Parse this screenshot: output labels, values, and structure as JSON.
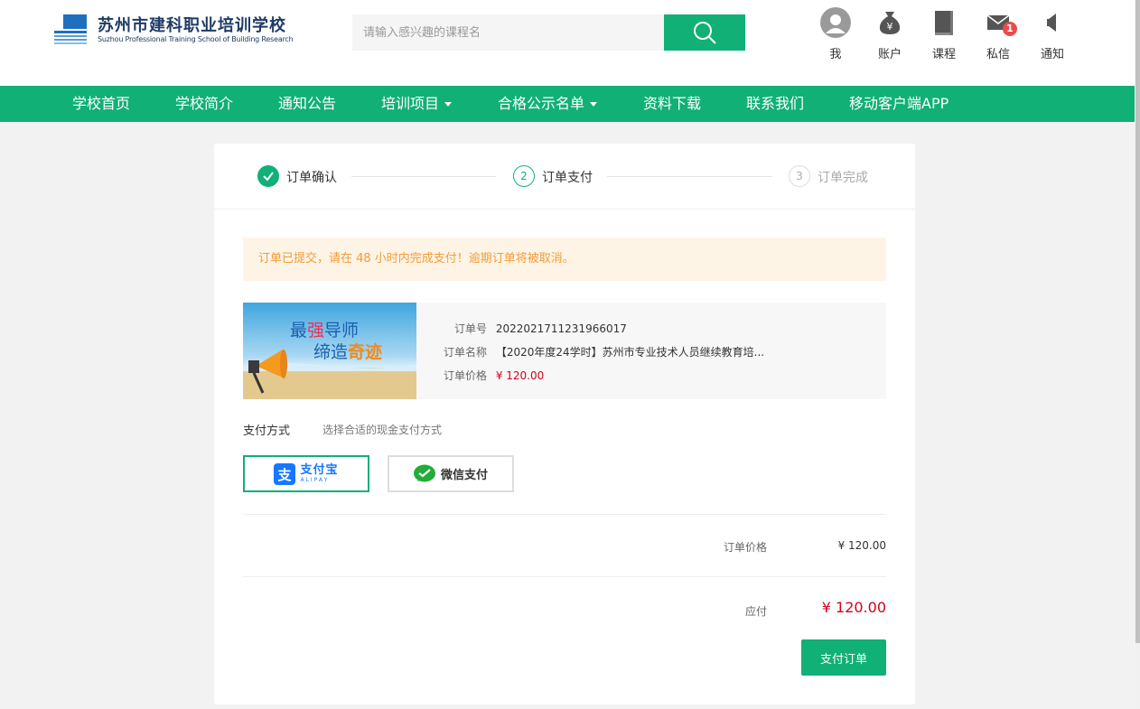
{
  "header": {
    "school_name_cn": "苏州市建科职业培训学校",
    "school_name_en": "Suzhou Professional Training School of Building Research",
    "search": {
      "placeholder": "请输入感兴趣的课程名",
      "button_icon": "search-icon"
    },
    "icons": [
      {
        "name": "user",
        "label": "我",
        "icon": "avatar-icon"
      },
      {
        "name": "account",
        "label": "账户",
        "icon": "money-bag-icon"
      },
      {
        "name": "course",
        "label": "课程",
        "icon": "book-icon"
      },
      {
        "name": "message",
        "label": "私信",
        "icon": "mail-icon",
        "badge": "1"
      },
      {
        "name": "notice",
        "label": "通知",
        "icon": "speaker-icon"
      }
    ]
  },
  "nav": {
    "items": [
      {
        "label": "学校首页"
      },
      {
        "label": "学校简介"
      },
      {
        "label": "通知公告"
      },
      {
        "label": "培训项目",
        "dropdown": true
      },
      {
        "label": "合格公示名单",
        "dropdown": true
      },
      {
        "label": "资料下载"
      },
      {
        "label": "联系我们"
      },
      {
        "label": "移动客户端APP"
      }
    ]
  },
  "steps": [
    {
      "index": "1",
      "label": "订单确认",
      "state": "done"
    },
    {
      "index": "2",
      "label": "订单支付",
      "state": "current"
    },
    {
      "index": "3",
      "label": "订单完成",
      "state": "pending"
    }
  ],
  "notice": "订单已提交，请在 48 小时内完成支付！逾期订单将被取消。",
  "order": {
    "banner_line1_a": "最",
    "banner_line1_b": "强",
    "banner_line1_c": "导师",
    "banner_line2_a": "缔造",
    "banner_line2_b": "奇迹",
    "number_label": "订单号",
    "number": "2022021711231966017",
    "name_label": "订单名称",
    "name": "【2020年度24学时】苏州市专业技术人员继续教育培...",
    "price_label": "订单价格",
    "price": "¥ 120.00"
  },
  "payment": {
    "title": "支付方式",
    "hint": "选择合适的现金支付方式",
    "alipay_label": "支付宝",
    "alipay_sub": "ALIPAY",
    "wechat_label": "微信支付",
    "selected": "alipay"
  },
  "summary": {
    "price_label": "订单价格",
    "price": "¥ 120.00",
    "due_label": "应付",
    "due": "¥ 120.00",
    "submit_label": "支付订单"
  },
  "colors": {
    "accent": "#10b077",
    "price_red": "#d0021b",
    "notice_text": "#f29b38",
    "notice_bg": "#fef4e6"
  }
}
